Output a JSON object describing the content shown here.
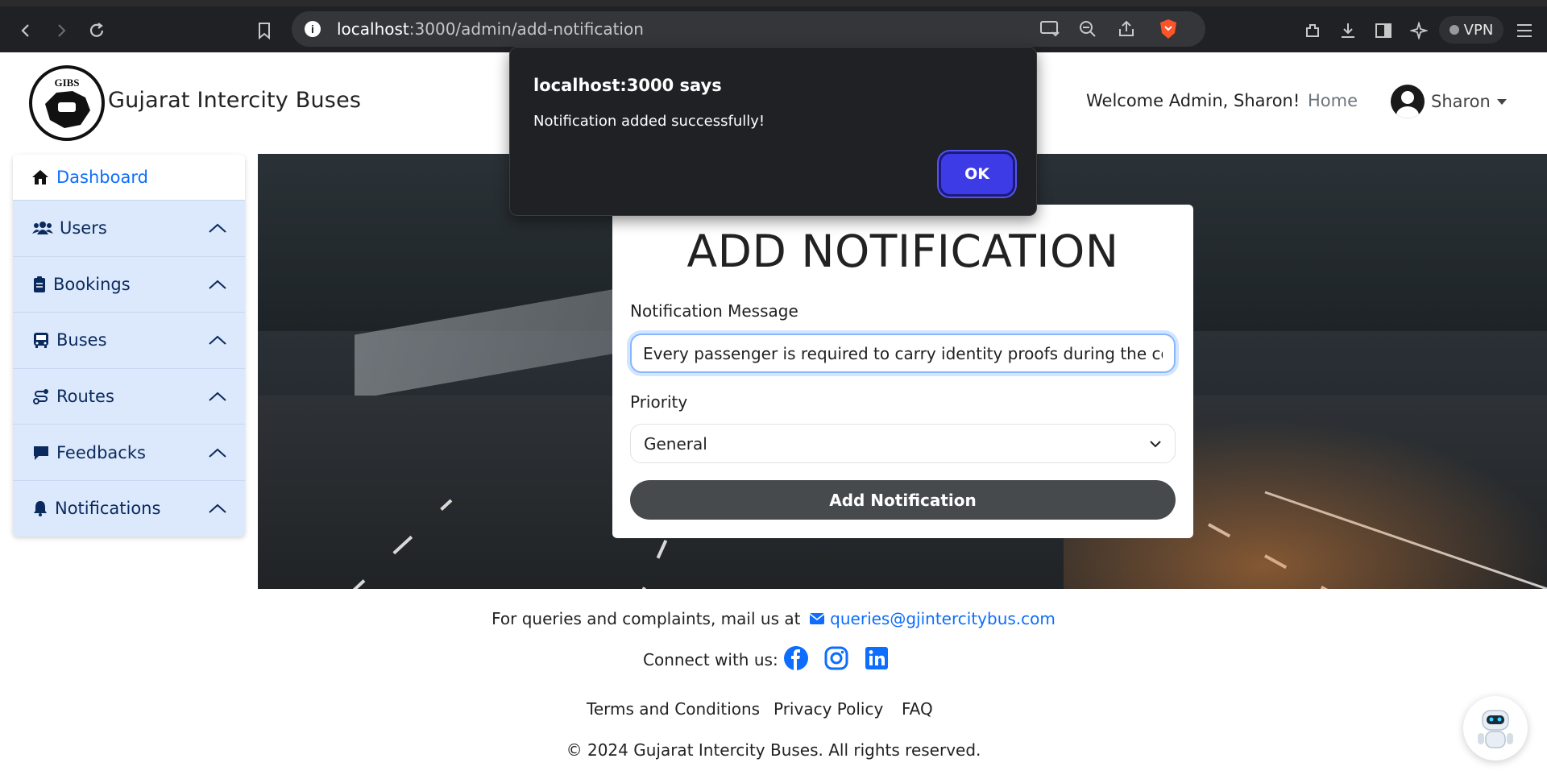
{
  "browser": {
    "url_host": "localhost",
    "url_path": ":3000/admin/add-notification",
    "vpn_label": "VPN"
  },
  "header": {
    "brand": "Gujarat Intercity Buses",
    "logo_text": "GIBS",
    "welcome": "Welcome Admin, Sharon!",
    "home": "Home",
    "user_name": "Sharon"
  },
  "sidebar": {
    "dashboard": "Dashboard",
    "items": [
      {
        "label": "Users",
        "icon": "users-icon"
      },
      {
        "label": "Bookings",
        "icon": "clipboard-icon"
      },
      {
        "label": "Buses",
        "icon": "bus-icon"
      },
      {
        "label": "Routes",
        "icon": "route-icon"
      },
      {
        "label": "Feedbacks",
        "icon": "comment-icon"
      },
      {
        "label": "Notifications",
        "icon": "bell-icon"
      }
    ]
  },
  "form": {
    "title": "ADD NOTIFICATION",
    "message_label": "Notification Message",
    "message_value": "Every passenger is required to carry identity proofs during the course of",
    "priority_label": "Priority",
    "priority_value": "General",
    "submit": "Add Notification"
  },
  "dialog": {
    "title": "localhost:3000 says",
    "message": "Notification added successfully!",
    "ok": "OK"
  },
  "footer": {
    "mail_text": "For queries and complaints, mail us at",
    "mail_link": "queries@gjintercitybus.com",
    "connect": "Connect with us:",
    "links": [
      "Terms and Conditions",
      "Privacy Policy",
      "FAQ"
    ],
    "copyright": "© 2024 Gujarat Intercity Buses. All rights reserved."
  },
  "colors": {
    "accent": "#0d6efd",
    "sidebar_bg": "#dce8fb",
    "dialog_ok": "#3d3be6",
    "button_dark": "#474a4d"
  }
}
